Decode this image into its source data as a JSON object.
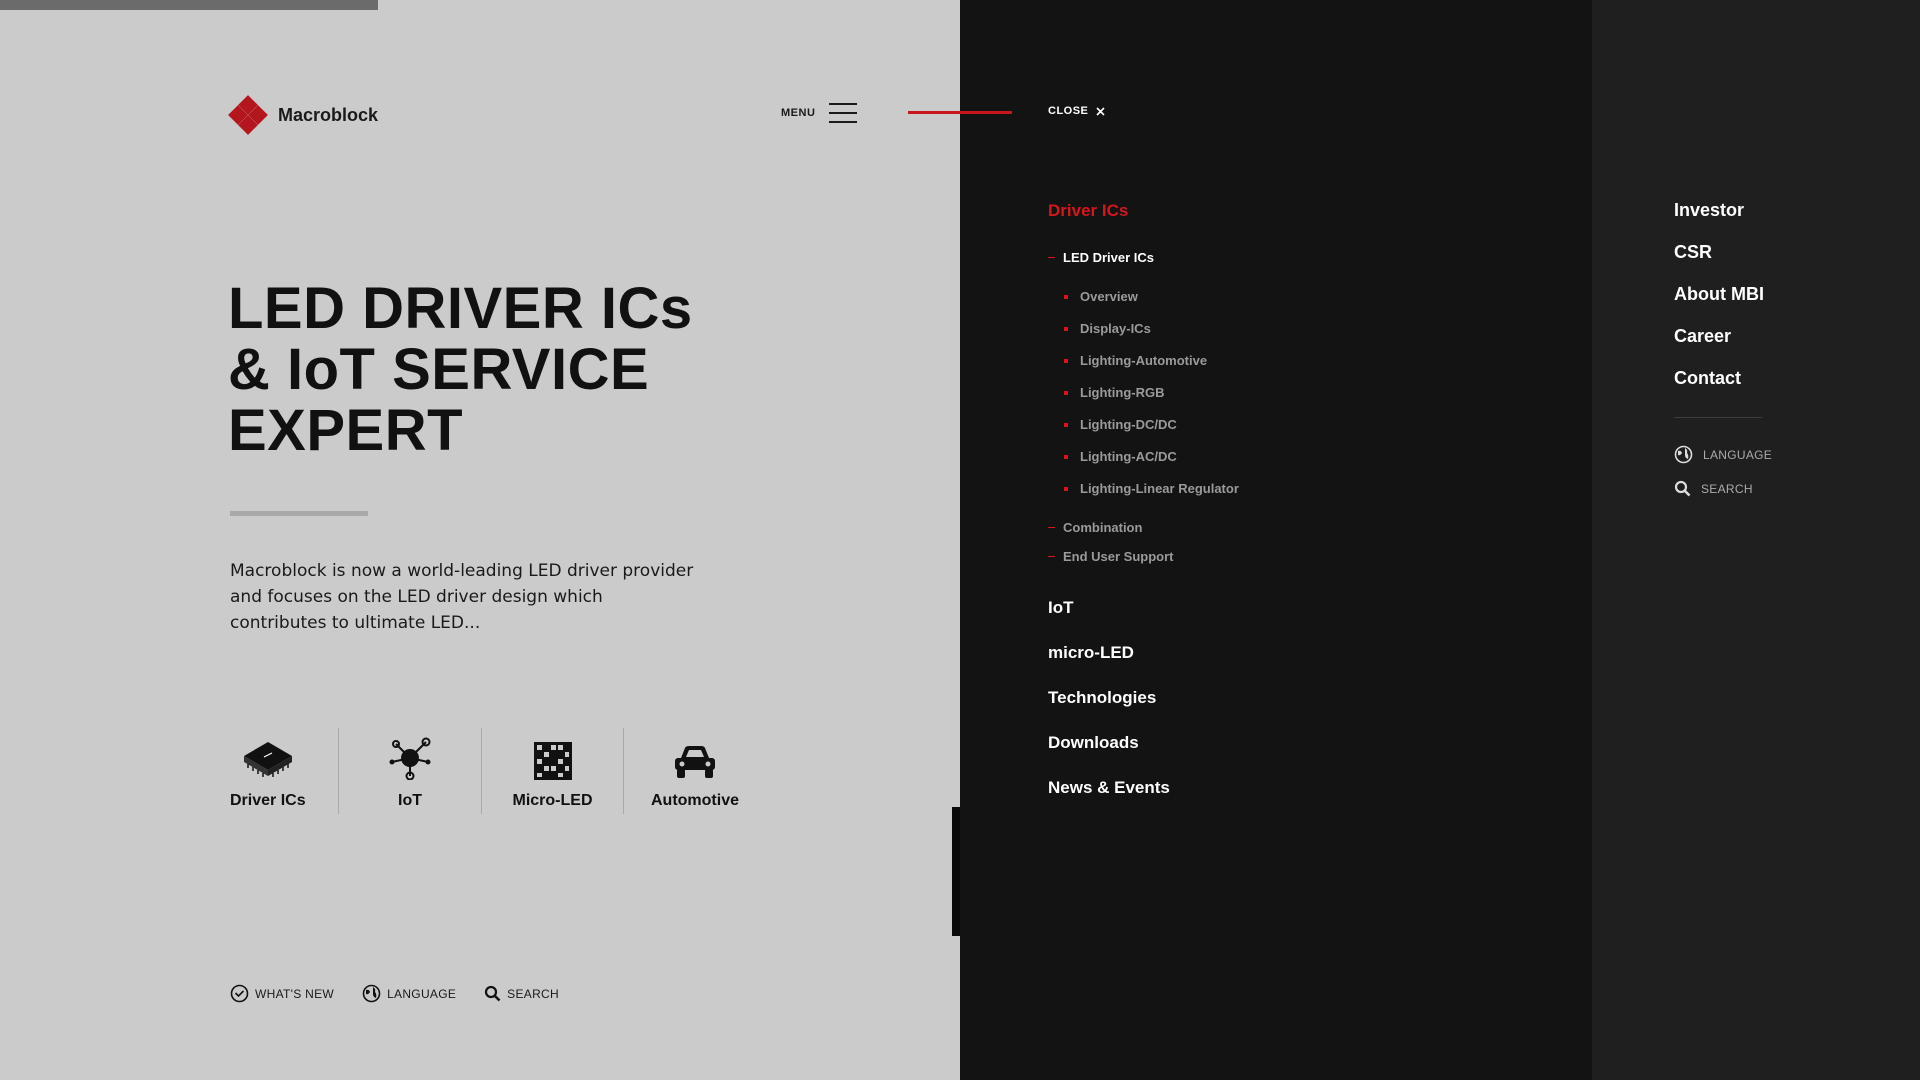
{
  "brand": {
    "name": "Macroblock",
    "accent": "#c8161d"
  },
  "header": {
    "menu_label": "MENU",
    "close_label": "CLOSE"
  },
  "hero": {
    "title_lines": [
      "LED DRIVER ICs",
      "& IoT SERVICE",
      "EXPERT"
    ],
    "description": "Macroblock is now a world-leading LED driver provider and focuses on the LED driver design which contributes to ultimate LED..."
  },
  "categories": [
    {
      "label": "Driver ICs",
      "icon": "chip-icon"
    },
    {
      "label": "IoT",
      "icon": "iot-network-icon"
    },
    {
      "label": "Micro-LED",
      "icon": "grid-matrix-icon"
    },
    {
      "label": "Automotive",
      "icon": "car-icon"
    }
  ],
  "bottom_util": {
    "whats_new": "WHAT'S NEW",
    "language": "LANGUAGE",
    "search": "SEARCH"
  },
  "nav": {
    "driver_ics": "Driver ICs",
    "led_driver_ics": "LED Driver ICs",
    "led_sub": [
      "Overview",
      "Display-ICs",
      "Lighting-Automotive",
      "Lighting-RGB",
      "Lighting-DC/DC",
      "Lighting-AC/DC",
      "Lighting-Linear Regulator"
    ],
    "combination": "Combination",
    "end_user_support": "End User Support",
    "iot": "IoT",
    "micro_led": "micro-LED",
    "technologies": "Technologies",
    "downloads": "Downloads",
    "news_events": "News & Events"
  },
  "side": {
    "links": [
      "Investor",
      "CSR",
      "About MBI",
      "Career",
      "Contact"
    ],
    "language": "LANGUAGE",
    "search": "SEARCH"
  }
}
